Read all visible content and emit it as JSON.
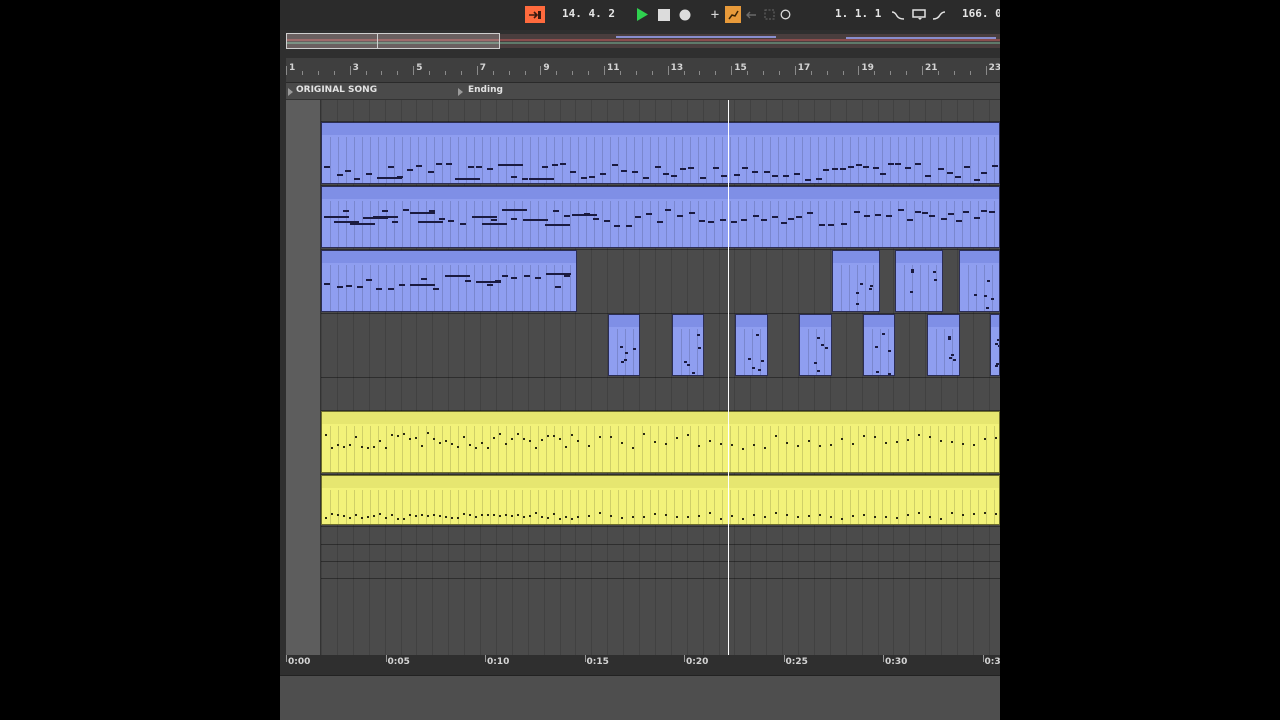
{
  "transport": {
    "arrangement_record_icon": "arrow-into-box-icon",
    "accent_color": "#ff6a3d",
    "position": "14.  4.  2",
    "play_icon": "play-triangle-icon",
    "stop_icon": "stop-square-icon",
    "record_icon": "record-circle-icon",
    "plus_label": "+",
    "loop_start": "1.  1.  1",
    "tempo": "166.  0"
  },
  "ruler": {
    "bars": [
      "1",
      "3",
      "5",
      "7",
      "9",
      "11",
      "13",
      "15",
      "17",
      "19",
      "21",
      "23"
    ]
  },
  "locators": [
    {
      "name": "ORIGINAL SONG"
    },
    {
      "name": "Ending"
    }
  ],
  "time_ruler": {
    "labels": [
      "0:00",
      "0:05",
      "0:10",
      "0:15",
      "0:20",
      "0:25",
      "0:30",
      "0:3"
    ]
  },
  "colors": {
    "midi_clip": "#8f9ef0",
    "audio_clip": "#f2f27a",
    "playhead": "#ffffff"
  }
}
